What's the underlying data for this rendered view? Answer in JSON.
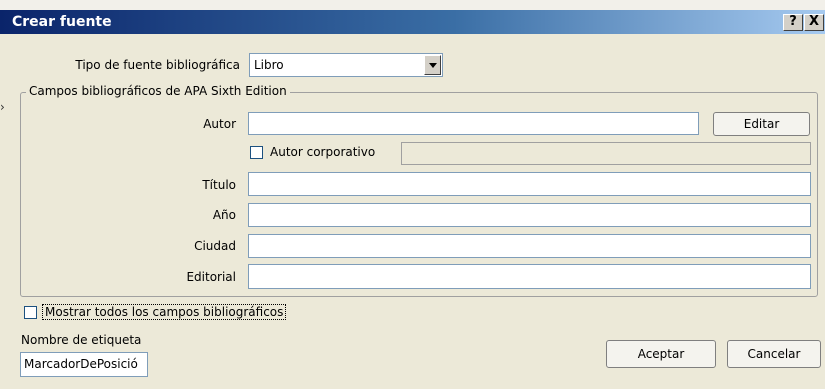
{
  "window": {
    "title": "Crear fuente",
    "help_button": "?",
    "close_button": "X"
  },
  "form": {
    "source_type_label": "Tipo de fuente bibliográfica",
    "source_type_value": "Libro",
    "group_label": "Campos bibliográficos de APA Sixth Edition",
    "author_label": "Autor",
    "author_value": "",
    "edit_button": "Editar",
    "corporate_author_label": "Autor corporativo",
    "corporate_author_checked": false,
    "title_label": "Título",
    "title_value": "",
    "year_label": "Año",
    "year_value": "",
    "city_label": "Ciudad",
    "city_value": "",
    "publisher_label": "Editorial",
    "publisher_value": "",
    "show_all_label": "Mostrar todos los campos bibliográficos",
    "show_all_checked": false,
    "tag_name_label": "Nombre de etiqueta",
    "tag_name_value": "MarcadorDePosició"
  },
  "actions": {
    "accept": "Aceptar",
    "cancel": "Cancelar"
  }
}
